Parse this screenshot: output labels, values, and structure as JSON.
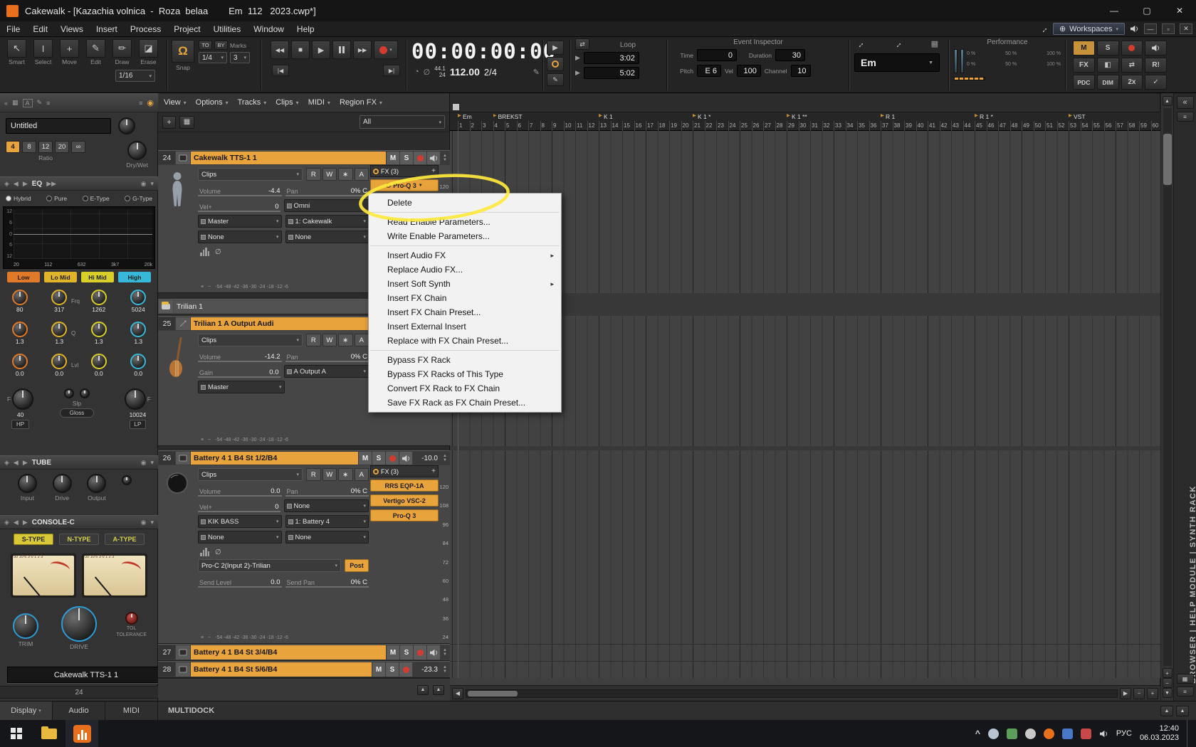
{
  "colors": {
    "accent": "#e8a33d",
    "record_red": "#d43c30",
    "highlight": "#ffe93c"
  },
  "icons": {
    "minimize": "—",
    "maximize": "▢",
    "close": "✕",
    "restore": "▫",
    "caret": "▾",
    "caret_solid": "▼",
    "caret_right": "▸",
    "left": "◀",
    "right": "▶",
    "up": "▲",
    "down": "▼",
    "dleft": "«",
    "plus": "+",
    "minus": "−",
    "check": "✓",
    "smart": "↖",
    "select": "I",
    "move": "+",
    "edit": "✎",
    "draw": "✏",
    "erase": "◪",
    "magnet": "Ω",
    "clock": "◔",
    "mute_wave": "∅",
    "pencil": "✎",
    "swap": "⇄",
    "globe": "⊕",
    "resize": "↔",
    "menu": "≡",
    "grid": "▦",
    "a_box": "A",
    "circle": "◉",
    "diamond": "◈",
    "rew": "◀◀",
    "ff": "▶▶",
    "stop": "■",
    "play": "▶",
    "prev": "|◀",
    "next": "▶|",
    "lang_caret": "^",
    "phase": "∅",
    "wave": "~",
    "tile": "◧"
  },
  "title_bar": {
    "title": "Cakewalk - [Kazachia volnica  -  Roza  belaa        Em  112   2023.cwp*]"
  },
  "menu_bar": {
    "items": [
      "File",
      "Edit",
      "Views",
      "Insert",
      "Process",
      "Project",
      "Utilities",
      "Window",
      "Help"
    ],
    "workspaces": "Workspaces"
  },
  "control_bar": {
    "tools": {
      "labels": [
        "Smart",
        "Select",
        "Move",
        "Edit",
        "Draw",
        "Erase"
      ],
      "resolution": "1/16"
    },
    "snap": {
      "label": "Snap",
      "to": "TO",
      "by": "BY",
      "marks": "Marks",
      "value": "1/4",
      "landmark": "3"
    },
    "time": {
      "main": "00:00:00:00",
      "rate": "44.1",
      "depth": "24",
      "tempo": "112.00",
      "meter": "2/4"
    },
    "loop": {
      "label": "Loop",
      "start": "3:02",
      "end": "5:02"
    },
    "inspector": {
      "label": "Event Inspector",
      "time_label": "Time",
      "time": "0",
      "duration_label": "Duration",
      "duration": "30",
      "pitch_label": "Pitch",
      "pitch": "E 6",
      "vel_label": "Vel",
      "vel": "100",
      "channel_label": "Channel",
      "channel": "10"
    },
    "key": "Em",
    "performance": {
      "label": "Performance",
      "ticks": [
        "0 %",
        "50 %",
        "100 %"
      ]
    },
    "status": {
      "mute": "M",
      "solo": "S",
      "fx": "FX",
      "reset": "R!",
      "pdc": "PDC",
      "dim": "DIM",
      "speed": "2x"
    }
  },
  "prochannel": {
    "preset": "Untitled",
    "ratios": [
      "4",
      "8",
      "12",
      "20",
      "∞"
    ],
    "ratio_label": "Ratio",
    "drywet_label": "Dry/Wet",
    "eq": {
      "title": "EQ",
      "types": [
        "Hybrid",
        "Pure",
        "E-Type",
        "G-Type"
      ],
      "db_labels": [
        "12",
        "6",
        "0",
        "6",
        "12"
      ],
      "freq_labels": [
        "20",
        "112",
        "632",
        "3k7",
        "20k"
      ],
      "bands": [
        {
          "name": "Low",
          "freq": "80",
          "q": "1.3",
          "lvl": "0.0",
          "color": "#e07a28"
        },
        {
          "name": "Lo Mid",
          "freq": "317",
          "q": "1.3",
          "lvl": "0.0",
          "color": "#e0b428"
        },
        {
          "name": "Hi Mid",
          "freq": "1262",
          "q": "1.3",
          "lvl": "0.0",
          "color": "#d8d028"
        },
        {
          "name": "High",
          "freq": "5024",
          "q": "1.3",
          "lvl": "0.0",
          "color": "#38b8d8"
        }
      ],
      "row_labels": {
        "frq": "Frq",
        "q": "Q",
        "lvl": "Lvl"
      },
      "f_label": "F",
      "hp_value": "40",
      "hp_label": "HP",
      "slp_label": "Slp",
      "gloss_label": "Gloss",
      "lp_value": "10024",
      "lp_label": "LP"
    },
    "tube": {
      "title": "TUBE",
      "knobs": [
        "Input",
        "Drive",
        "Output"
      ]
    },
    "console": {
      "title": "CONSOLE-C",
      "types": [
        "S-TYPE",
        "N-TYPE",
        "A-TYPE"
      ],
      "vu_scale": "30 10 6 3 0 1 2 3",
      "knobs": [
        "TRIM",
        "DRIVE",
        "TOLERANCE"
      ],
      "tol_label": "TOL"
    },
    "module_name": "Cakewalk TTS-1 1",
    "module_number": "24",
    "tabs": [
      "Display",
      "Audio",
      "MIDI"
    ]
  },
  "track_pane": {
    "menus": [
      "View",
      "Options",
      "Tracks",
      "Clips",
      "MIDI",
      "Region FX"
    ],
    "filter_all": "All",
    "btn": {
      "mute": "M",
      "solo": "S"
    },
    "auto_buttons": [
      "R",
      "W",
      "∗",
      "A"
    ],
    "meter_db_scale": "-54   -48   -42   -36   -30   -24   -18   -12   -6",
    "folder": {
      "name": "Trilian 1"
    },
    "tracks": {
      "t24": {
        "number": "24",
        "name": "Cakewalk TTS-1 1",
        "clips": "Clips",
        "volume_label": "Volume",
        "volume": "-4.4",
        "pan_label": "Pan",
        "pan": "0% C",
        "vel_label": "Vel+",
        "vel": "0",
        "input": "Omni",
        "out1": "Master",
        "out2": "1: Cakewalk",
        "send1": "None",
        "send2": "None",
        "fx_header": "FX (3)",
        "fx_chip": "Pro-Q 3"
      },
      "t25": {
        "number": "25",
        "name": "Trilian 1 A Output Audi",
        "clips": "Clips",
        "volume_label": "Volume",
        "volume": "-14.2",
        "pan_label": "Pan",
        "pan": "0% C",
        "gain_label": "Gain",
        "gain": "0.0",
        "out1": "A Output A",
        "out2": "Master"
      },
      "t26": {
        "number": "26",
        "name": "Battery 4 1 B4 St 1/2/B4",
        "peak": "-10.0",
        "clips": "Clips",
        "volume_label": "Volume",
        "volume": "0.0",
        "pan_label": "Pan",
        "pan": "0% C",
        "vel_label": "Vel+",
        "vel": "0",
        "input": "None",
        "out1": "KIK  BASS",
        "out2": "1: Battery 4",
        "send1": "None",
        "send2": "None",
        "fx_header": "FX (3)",
        "fx_chips": [
          "RRS EQP-1A",
          "Vertigo VSC-2",
          "Pro-Q 3"
        ],
        "send_fx": "Pro-C 2(Input 2)-Trilian",
        "post": "Post",
        "send_level_label": "Send Level",
        "send_level": "0.0",
        "send_pan_label": "Send Pan",
        "send_pan": "0% C"
      },
      "t27": {
        "number": "27",
        "name": "Battery 4 1 B4 St 3/4/B4"
      },
      "t28": {
        "number": "28",
        "name": "Battery 4 1 B4 St 5/6/B4",
        "peak": "-23.3"
      }
    },
    "multidock": "MULTIDOCK"
  },
  "context_menu": {
    "items": [
      {
        "label": "Delete"
      },
      {
        "sep": true
      },
      {
        "label": "Read Enable Parameters..."
      },
      {
        "label": "Write Enable Parameters..."
      },
      {
        "sep": true
      },
      {
        "label": "Insert Audio FX",
        "submenu": true
      },
      {
        "label": "Replace Audio FX..."
      },
      {
        "label": "Insert Soft Synth",
        "submenu": true
      },
      {
        "label": "Insert FX Chain"
      },
      {
        "label": "Insert FX Chain Preset..."
      },
      {
        "label": "Insert External Insert"
      },
      {
        "label": "Replace with FX Chain Preset..."
      },
      {
        "sep": true
      },
      {
        "label": "Bypass FX Rack"
      },
      {
        "label": "Bypass FX Racks of This Type"
      },
      {
        "label": "Convert FX Rack to FX Chain"
      },
      {
        "label": "Save FX Rack as FX Chain Preset..."
      }
    ]
  },
  "timeline": {
    "markers": [
      {
        "label": "Em",
        "measure": 1
      },
      {
        "label": "BREKST",
        "measure": 4
      },
      {
        "label": "K 1",
        "measure": 13
      },
      {
        "label": "K 1 *",
        "measure": 21
      },
      {
        "label": "K 1 **",
        "measure": 29
      },
      {
        "label": "R 1",
        "measure": 37
      },
      {
        "label": "R 1 *",
        "measure": 45
      },
      {
        "label": "VST",
        "measure": 53
      }
    ],
    "measures": [
      1,
      2,
      3,
      4,
      5,
      6,
      7,
      8,
      9,
      10,
      11,
      12,
      13,
      14,
      15,
      16,
      17,
      18,
      19,
      20,
      21,
      22,
      23,
      24,
      25,
      26,
      27,
      28,
      29,
      30,
      31,
      32,
      33,
      34,
      35,
      36,
      37,
      38,
      39,
      40,
      41,
      42,
      43,
      44,
      45,
      46,
      47,
      48,
      49,
      50,
      51,
      52,
      53,
      54,
      55,
      56,
      57,
      58,
      59,
      60
    ],
    "velocity_scale": [
      "120",
      "108",
      "96",
      "84",
      "72",
      "60",
      "48",
      "36",
      "24"
    ]
  },
  "right_dock": {
    "label": "BROWSER    |    HELP MODULE    |    SYNTH RACK"
  },
  "taskbar": {
    "lang": "РУС",
    "time": "12:40",
    "date": "06.03.2023"
  }
}
